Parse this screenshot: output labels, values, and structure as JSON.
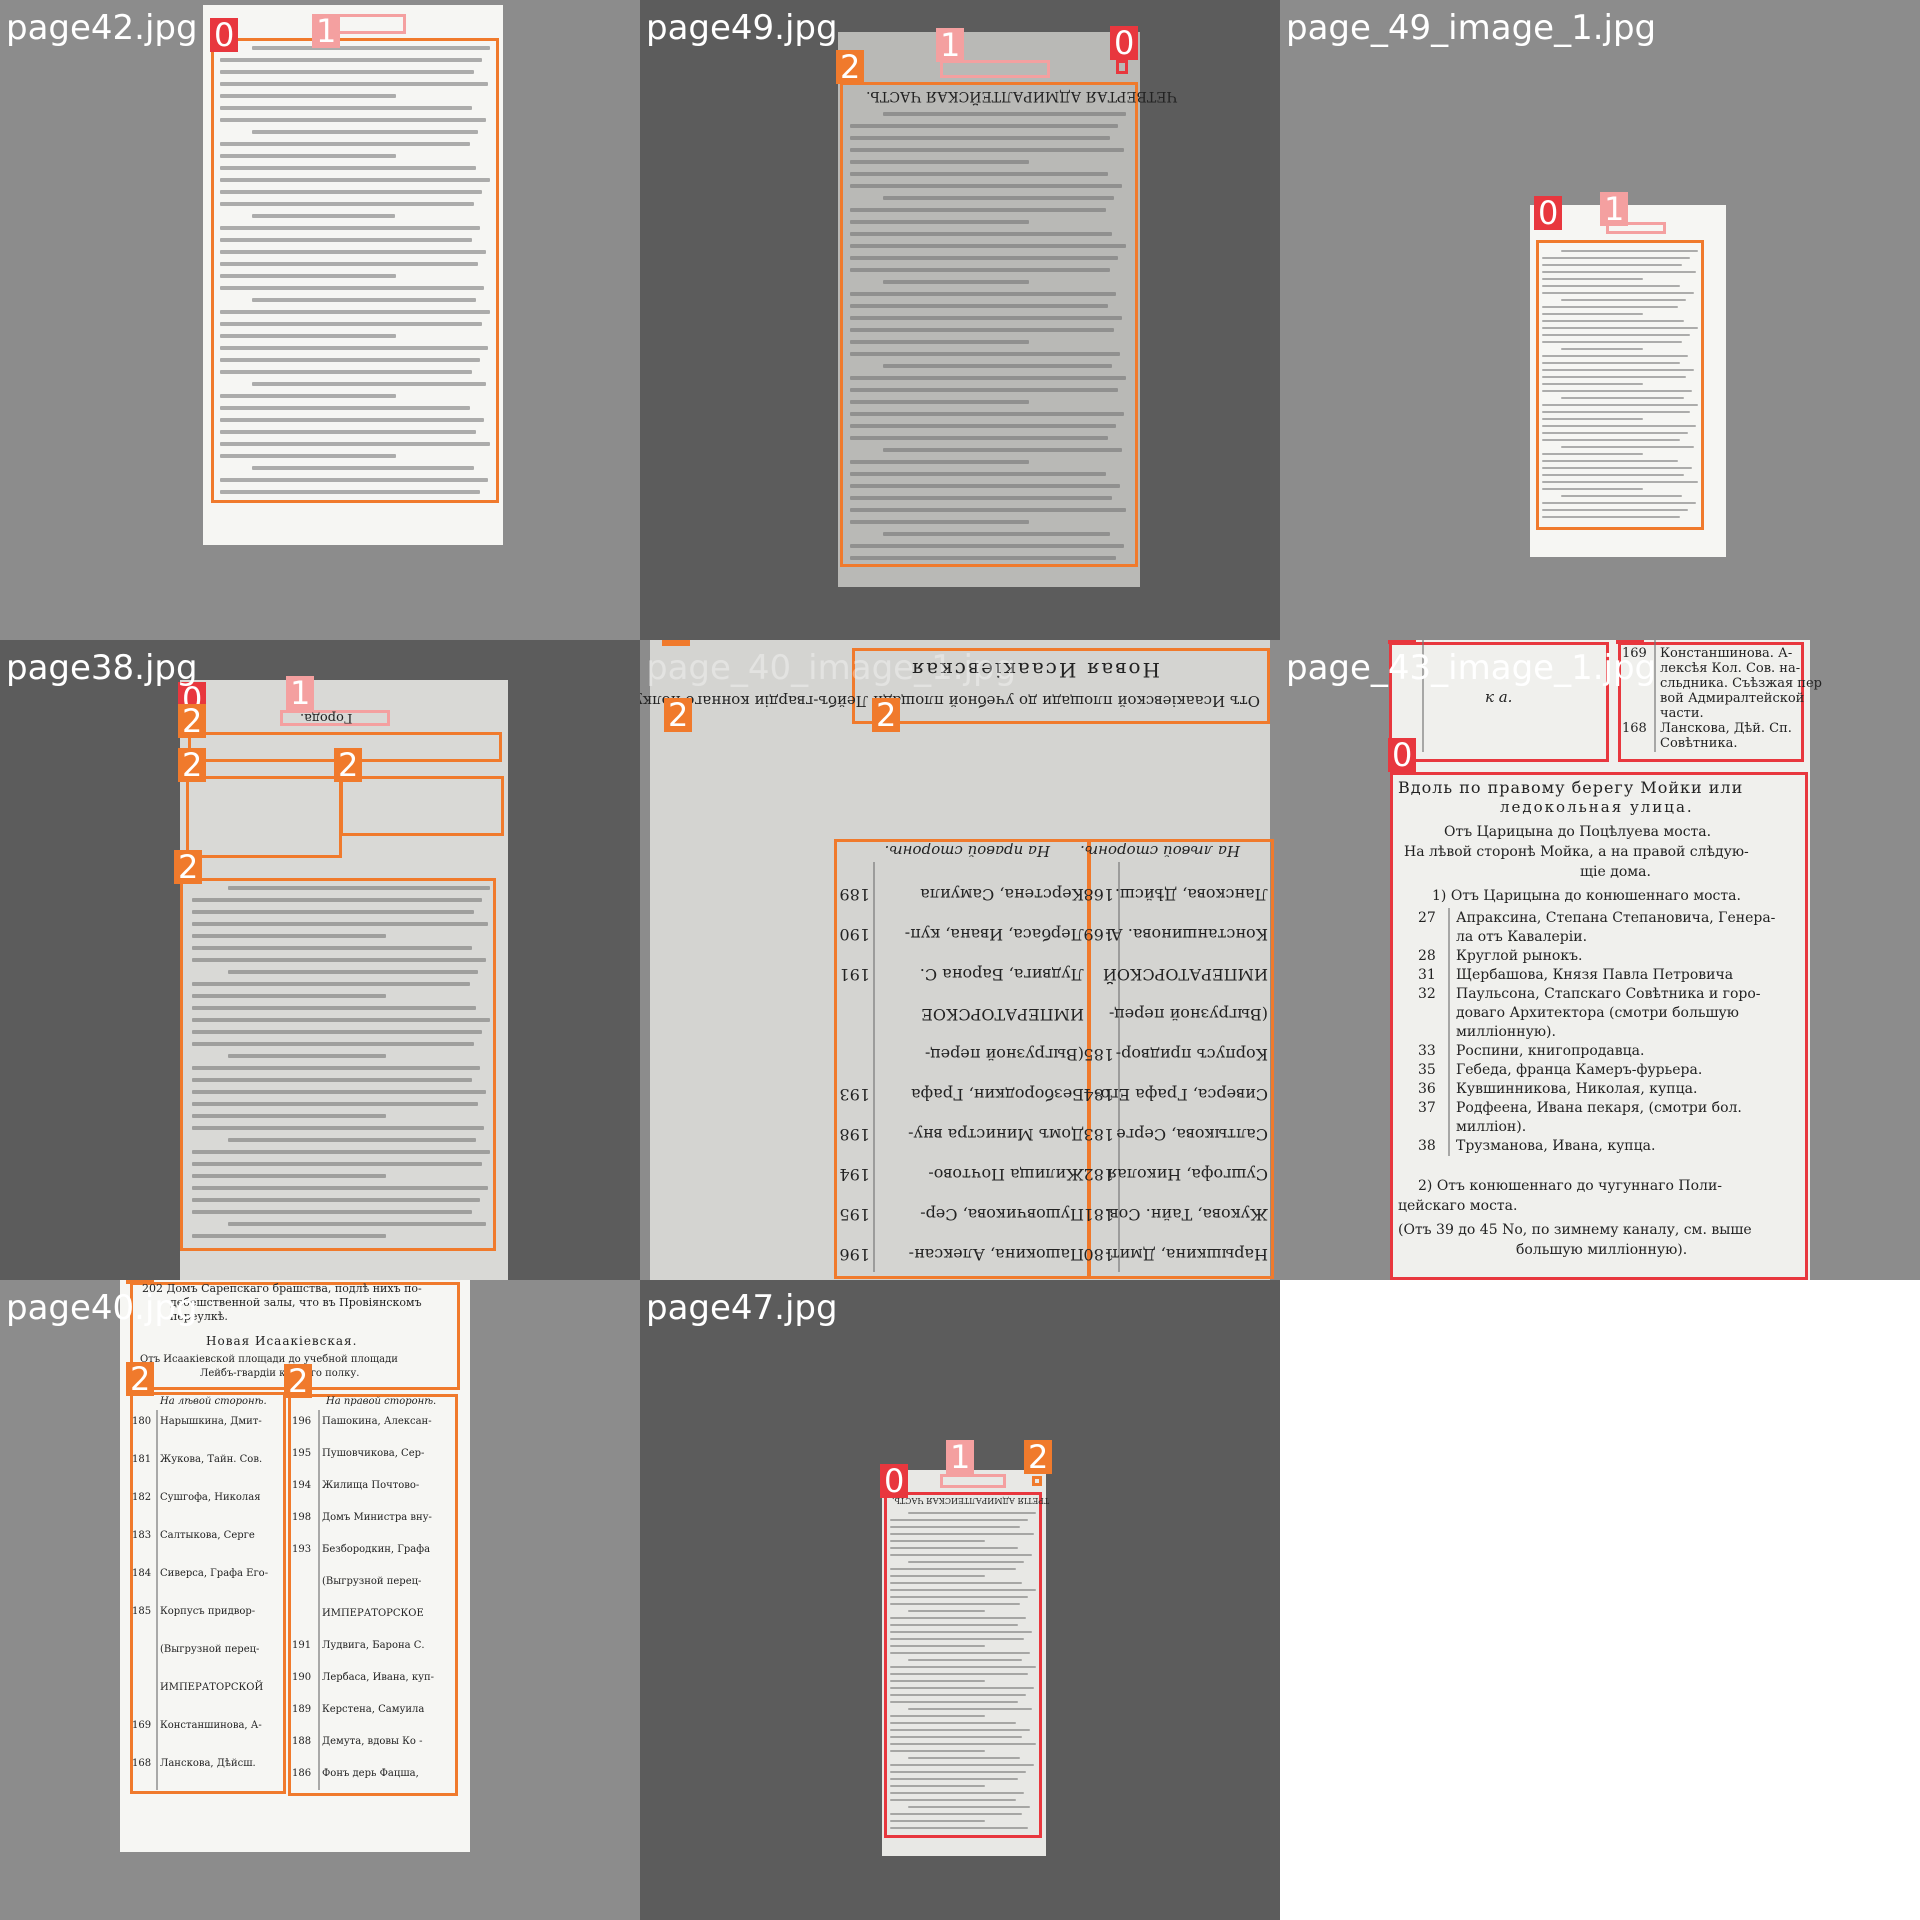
{
  "colors": {
    "class0": "#e8373e",
    "class1": "#f4a0a0",
    "class2": "#f07a2c",
    "tile_bg_a": "#8c8c8c",
    "tile_bg_b": "#5c5c5c"
  },
  "tiles": [
    {
      "label": "page42.jpg",
      "bg": "#8c8c8c",
      "boxes": [
        {
          "cls": "0"
        },
        {
          "cls": "1"
        }
      ]
    },
    {
      "label": "page49.jpg",
      "bg": "#5c5c5c",
      "boxes": [
        {
          "cls": "0"
        },
        {
          "cls": "1"
        },
        {
          "cls": "2"
        }
      ],
      "header": "ЧЕТВЕРТАЯ АДМИРАЛТЕЙСКАЯ ЧАСТЬ."
    },
    {
      "label": "page_49_image_1.jpg",
      "bg": "#8c8c8c",
      "boxes": [
        {
          "cls": "0"
        },
        {
          "cls": "1"
        }
      ]
    },
    {
      "label": "page38.jpg",
      "bg": "#5c5c5c",
      "boxes": [
        {
          "cls": "0"
        },
        {
          "cls": "1"
        },
        {
          "cls": "2"
        },
        {
          "cls": "2"
        },
        {
          "cls": "2"
        },
        {
          "cls": "2"
        }
      ],
      "header": "Города."
    },
    {
      "label": "page_40_image_1.jpg",
      "bg": "#8c8c8c",
      "boxes": [
        {
          "cls": "2"
        },
        {
          "cls": "2"
        },
        {
          "cls": "2"
        }
      ],
      "title": "Новая Исаакіевская",
      "subtitle": "Отъ Исаакіевской площади до учебной площади Лейбъ-гвардіи коннаго полку.",
      "left_head": "На лѣвой сторонѣ.",
      "right_head": "На правой сторонѣ.",
      "left_rows": [
        {
          "n": "180",
          "t": "Нарышкина, Дмит-"
        },
        {
          "n": "181",
          "t": "Жукова, Тайн. Сов."
        },
        {
          "n": "182",
          "t": "Сушгофа, Николая"
        },
        {
          "n": "183",
          "t": "Салтыкова, Серге"
        },
        {
          "n": "184",
          "t": "Сиверса, Графа Его-"
        },
        {
          "n": "185",
          "t": "Корпусъ придвор-"
        },
        {
          "n": "",
          "t": "(Выгрузной перец-"
        },
        {
          "n": "",
          "t": "ИМПЕРАТОРСКОЙ"
        },
        {
          "n": "169",
          "t": "Констаншинова. А-"
        },
        {
          "n": "168",
          "t": "Ланскова, Дѣйсш."
        }
      ],
      "right_rows": [
        {
          "n": "196",
          "t": "Пашокина, Алексан-"
        },
        {
          "n": "195",
          "t": "Пушовчикова, Сер-"
        },
        {
          "n": "194",
          "t": "Жилища Почтово-"
        },
        {
          "n": "198",
          "t": "Домъ Министра вну-"
        },
        {
          "n": "193",
          "t": "Безбородкин, Графа"
        },
        {
          "n": "",
          "t": "(Выгрузной перец-"
        },
        {
          "n": "",
          "t": "ИМПЕРАТОРСКОЕ"
        },
        {
          "n": "191",
          "t": "Лудвига, Барона С."
        },
        {
          "n": "190",
          "t": "Лербаса, Ивана, куп-"
        },
        {
          "n": "189",
          "t": "Керстена, Самуила"
        }
      ]
    },
    {
      "label": "page_43_image_1.jpg",
      "bg": "#8c8c8c",
      "boxes": [
        {
          "cls": "0"
        },
        {
          "cls": "0"
        },
        {
          "cls": "0"
        }
      ],
      "top_left": "к а.",
      "top_right": [
        {
          "n": "169",
          "t": "Констаншинова. А-"
        },
        {
          "n": "",
          "t": "лексѣя Кол. Сов. на-"
        },
        {
          "n": "",
          "t": "сльдника. Съѣзжая пер"
        },
        {
          "n": "",
          "t": "вой Адмиралтейской"
        },
        {
          "n": "",
          "t": "части."
        },
        {
          "n": "168",
          "t": "Ланскова, Дѣй. Сп."
        },
        {
          "n": "",
          "t": "Совѣтника."
        }
      ],
      "heading": "Вдоль по правому берегу Мойки или",
      "heading2": "ледокольная улица.",
      "intro1": "Отъ Царицына до Поцѣлуева моста.",
      "intro2": "На лѣвой сторонѣ Мойка, а на правой слѣдую-",
      "intro3": "щіе дома.",
      "sub1": "1) Отъ Царицына до конюшеннаго моста.",
      "rows": [
        {
          "n": "27",
          "t": "Апраксина, Степана Степановича, Генера-"
        },
        {
          "n": "",
          "t": "ла отъ Кавалеріи."
        },
        {
          "n": "28",
          "t": "Круглой рынокъ."
        },
        {
          "n": "31",
          "t": "Щербашова, Князя Павла Петровича"
        },
        {
          "n": "32",
          "t": "Паульсона, Стапскаго Совѣтника и горо-"
        },
        {
          "n": "",
          "t": "доваго Архитектора (смотри большую"
        },
        {
          "n": "",
          "t": "милліонную)."
        },
        {
          "n": "33",
          "t": "Роспини, книгопродавца."
        },
        {
          "n": "35",
          "t": "Гебеда, франца Камеръ-фурьера."
        },
        {
          "n": "36",
          "t": "Кувшинникова, Николая, купца."
        },
        {
          "n": "37",
          "t": "Родфеена, Ивана пекаря, (смотри бол."
        },
        {
          "n": "",
          "t": "милліон)."
        },
        {
          "n": "38",
          "t": "Трузманова, Ивана, купца."
        }
      ],
      "sub2": "2) Отъ конюшеннаго до чугуннаго Поли-",
      "sub2b": "цейскаго моста.",
      "sub3": "(Отъ 39 до 45 No, по зимнему каналу, см. выше",
      "sub3b": "большую милліонную)."
    },
    {
      "label": "page40.jpg",
      "bg": "#8c8c8c",
      "boxes": [
        {
          "cls": "2"
        },
        {
          "cls": "2"
        },
        {
          "cls": "2"
        }
      ],
      "top_line": "202 Домъ Сарепскаго брашства, подлѣ нихъ по-",
      "top_line2": "дебешственной залы, что въ Провіянскомъ",
      "top_line3": "переулкѣ.",
      "title": "Новая Исаакіевская.",
      "subtitle": "Отъ Исаакіевской площади до учебной площади",
      "subtitle2": "Лейбъ-гвардіи коннаго полку.",
      "left_head": "На лѣвой сторонѣ.",
      "right_head": "На правой сторонѣ.",
      "left_rows": [
        {
          "n": "180",
          "t": "Нарышкина, Дмит-"
        },
        {
          "n": "181",
          "t": "Жукова, Тайн. Сов."
        },
        {
          "n": "182",
          "t": "Сушгофа, Николая"
        },
        {
          "n": "183",
          "t": "Салтыкова, Серге"
        },
        {
          "n": "184",
          "t": "Сиверса, Графа Его-"
        },
        {
          "n": "185",
          "t": "Корпусъ придвор-"
        },
        {
          "n": "",
          "t": "(Выгрузной перец-"
        },
        {
          "n": "",
          "t": "ИМПЕРАТОРСКОЙ"
        },
        {
          "n": "169",
          "t": "Констаншинова, А-"
        },
        {
          "n": "168",
          "t": "Ланскова, Дѣйсш."
        }
      ],
      "right_rows": [
        {
          "n": "196",
          "t": "Пашокина, Алексан-"
        },
        {
          "n": "195",
          "t": "Пушовчикова, Сер-"
        },
        {
          "n": "194",
          "t": "Жилища Почтово-"
        },
        {
          "n": "198",
          "t": "Домъ Министра вну-"
        },
        {
          "n": "193",
          "t": "Безбородкин, Графа"
        },
        {
          "n": "",
          "t": "(Выгрузной перец-"
        },
        {
          "n": "",
          "t": "ИМПЕРАТОРСКОЕ"
        },
        {
          "n": "191",
          "t": "Лудвига, Барона С."
        },
        {
          "n": "190",
          "t": "Лербаса, Ивана, куп-"
        },
        {
          "n": "189",
          "t": "Керстена, Самуила"
        },
        {
          "n": "188",
          "t": "Демута, вдовы Ко -"
        },
        {
          "n": "186",
          "t": "Фонъ дерь Фацша,"
        }
      ]
    },
    {
      "label": "page47.jpg",
      "bg": "#5c5c5c",
      "boxes": [
        {
          "cls": "0"
        },
        {
          "cls": "1"
        },
        {
          "cls": "2"
        }
      ],
      "header": "ТРЕТІЯ АДМИРАЛТЕЙСКАЯ ЧАСТЬ."
    }
  ]
}
